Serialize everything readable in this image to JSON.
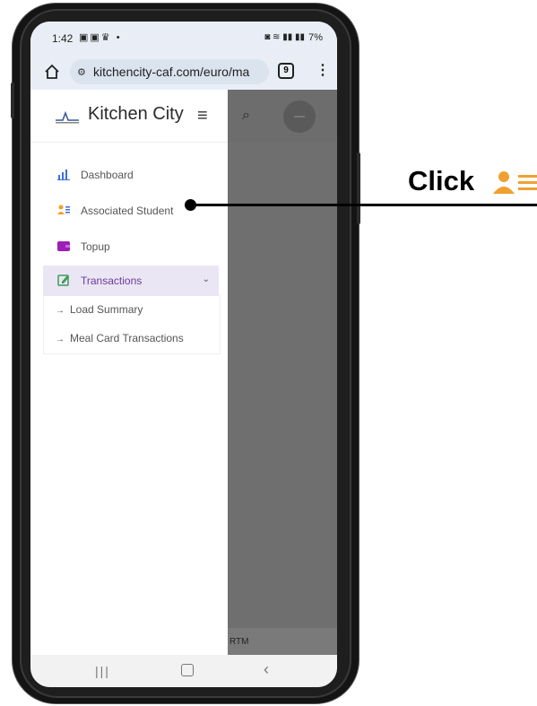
{
  "status_bar": {
    "time": "1:42",
    "battery": "7%"
  },
  "browser": {
    "url": "kitchencity-caf.com/euro/ma",
    "tab_count": "9"
  },
  "app": {
    "brand_title": "Kitchen City",
    "sidebar": {
      "items": [
        {
          "label": "Dashboard",
          "icon": "bar-chart-icon"
        },
        {
          "label": "Associated Student",
          "icon": "student-list-icon"
        },
        {
          "label": "Topup",
          "icon": "wallet-icon"
        },
        {
          "label": "Transactions",
          "icon": "edit-icon",
          "active": true
        }
      ],
      "sub_items": [
        {
          "label": "Load Summary"
        },
        {
          "label": "Meal Card Transactions"
        }
      ]
    },
    "footer_text": "RTM"
  },
  "callout": {
    "text": "Click"
  },
  "colors": {
    "accent_purple": "#6b3aa0",
    "icon_orange": "#f0a030",
    "icon_blue": "#3d6fd8",
    "overlay_gray": "#6f6f6f"
  }
}
